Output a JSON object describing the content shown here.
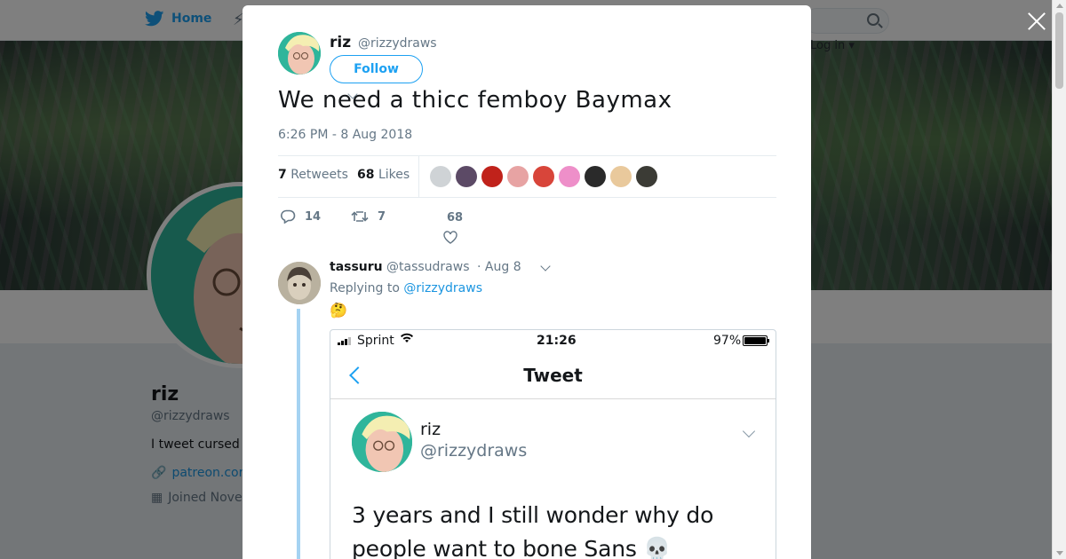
{
  "nav": {
    "home_label": "Home",
    "login_label": "Log in ▾"
  },
  "profile": {
    "name": "riz",
    "handle": "@rizzydraws",
    "bio": "I tweet cursed",
    "link": "patreon.cor",
    "joined": "Joined Nove"
  },
  "tweet": {
    "author_name": "riz",
    "author_handle": "@rizzydraws",
    "follow_label": "Follow",
    "text": "We need a thicc femboy Baymax",
    "timestamp": "6:26 PM - 8 Aug 2018",
    "retweets_count": "7",
    "retweets_label": "Retweets",
    "likes_count": "68",
    "likes_label": "Likes",
    "reply_count": "14",
    "retweet_action_count": "7",
    "like_action_count": "68",
    "liker_colors": [
      "#cfd3d6",
      "#5c4a66",
      "#c0221b",
      "#e7a3a3",
      "#d8453a",
      "#ee8fc9",
      "#2a2a2a",
      "#e9c99c",
      "#3b3b35"
    ]
  },
  "reply": {
    "name": "tassuru",
    "handle": "@tassudraws",
    "time": "· Aug 8",
    "replying_prefix": "Replying to",
    "replying_to": "@rizzydraws",
    "emoji": "🤔"
  },
  "screenshot": {
    "carrier": "Sprint",
    "clock": "21:26",
    "battery": "97%",
    "title": "Tweet",
    "name": "riz",
    "handle": "@rizzydraws",
    "text": "3 years and I still wonder why do people want to bone Sans 💀"
  },
  "colors": {
    "accent": "#1da1f2",
    "link": "#1b95e0",
    "muted": "#657786",
    "thread_line": "#a5d3f2"
  },
  "icons": {
    "home": "twitter-bird-icon",
    "moments": "lightning-icon",
    "search": "search-icon",
    "close": "close-icon",
    "reply": "reply-icon",
    "retweet": "retweet-icon",
    "like": "heart-icon",
    "link": "link-icon",
    "calendar": "calendar-icon"
  }
}
